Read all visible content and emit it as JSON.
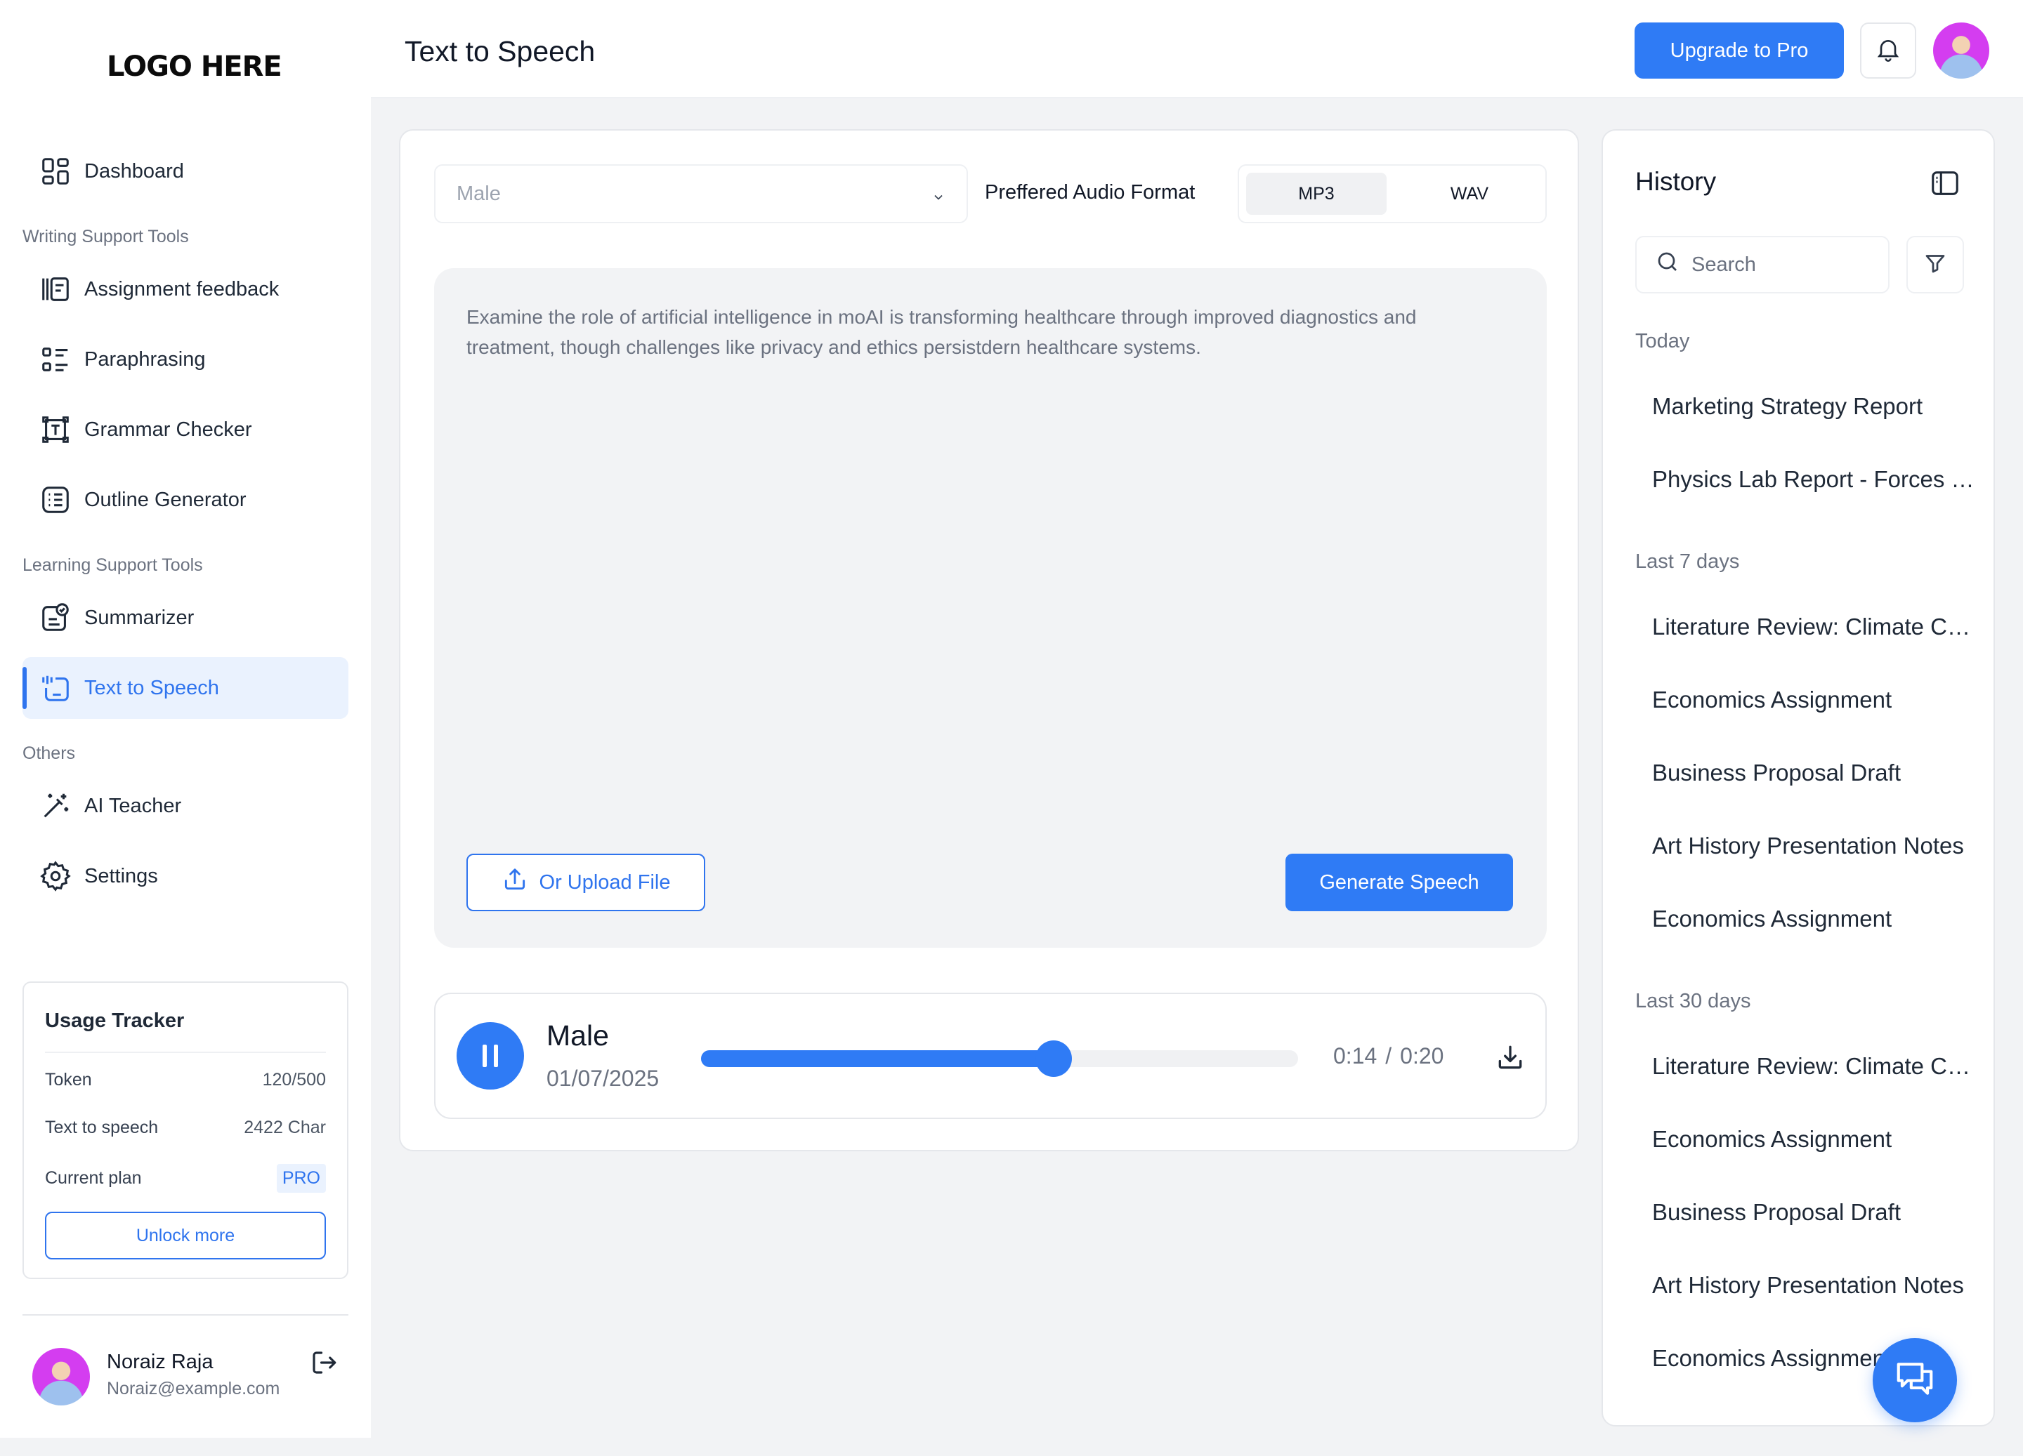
{
  "brand": {
    "logo_text": "LOGO HERE"
  },
  "sidebar": {
    "items": [
      {
        "label": "Dashboard",
        "icon": "dashboard-icon"
      },
      {
        "label": "Assignment feedback",
        "icon": "assignment-icon"
      },
      {
        "label": "Paraphrasing",
        "icon": "paraphrase-icon"
      },
      {
        "label": "Grammar Checker",
        "icon": "grammar-icon"
      },
      {
        "label": "Outline Generator",
        "icon": "outline-icon"
      },
      {
        "label": "Summarizer",
        "icon": "summarizer-icon"
      },
      {
        "label": "Text to Speech",
        "icon": "text-to-speech-icon",
        "active": true
      },
      {
        "label": "AI Teacher",
        "icon": "magic-wand-icon"
      },
      {
        "label": "Settings",
        "icon": "gear-icon"
      }
    ],
    "sections": {
      "writing": "Writing Support Tools",
      "learning": "Learning Support Tools",
      "others": "Others"
    }
  },
  "usage": {
    "title": "Usage Tracker",
    "token_label": "Token",
    "token_value": "120/500",
    "tts_label": "Text to speech",
    "tts_value": "2422 Char",
    "plan_label": "Current plan",
    "plan_value": "PRO",
    "unlock_label": "Unlock more"
  },
  "user": {
    "name": "Noraiz Raja",
    "email": "Noraiz@example.com"
  },
  "header": {
    "title": "Text to Speech",
    "upgrade_label": "Upgrade to Pro"
  },
  "main": {
    "voice_selected": "Male",
    "format_label": "Preffered Audio Format",
    "formats": [
      "MP3",
      "WAV"
    ],
    "selected_format": "MP3",
    "input_text": "Examine the role of artificial intelligence in moAI is transforming healthcare through improved diagnostics and treatment, though challenges like privacy and ethics persistdern healthcare systems.",
    "upload_label": "Or Upload File",
    "generate_label": "Generate Speech"
  },
  "player": {
    "voice": "Male",
    "date": "01/07/2025",
    "current_time": "0:14",
    "separator": "/",
    "total_time": "0:20",
    "progress": 0.59
  },
  "history": {
    "title": "History",
    "search_placeholder": "Search",
    "groups": [
      {
        "label": "Today",
        "items": [
          "Marketing Strategy Report",
          "Physics Lab Report - Forces and Motion"
        ]
      },
      {
        "label": "Last 7 days",
        "items": [
          "Literature Review: Climate Change",
          "Economics Assignment",
          "Business Proposal Draft",
          "Art History Presentation Notes",
          "Economics Assignment"
        ]
      },
      {
        "label": "Last 30 days",
        "items": [
          "Literature Review: Climate Change",
          "Economics Assignment",
          "Business Proposal Draft",
          "Art History Presentation Notes",
          "Economics Assignment"
        ]
      }
    ]
  },
  "colors": {
    "accent": "#2F7BF5",
    "active_bg": "#EAF2FE",
    "page_bg": "#F2F3F5"
  }
}
